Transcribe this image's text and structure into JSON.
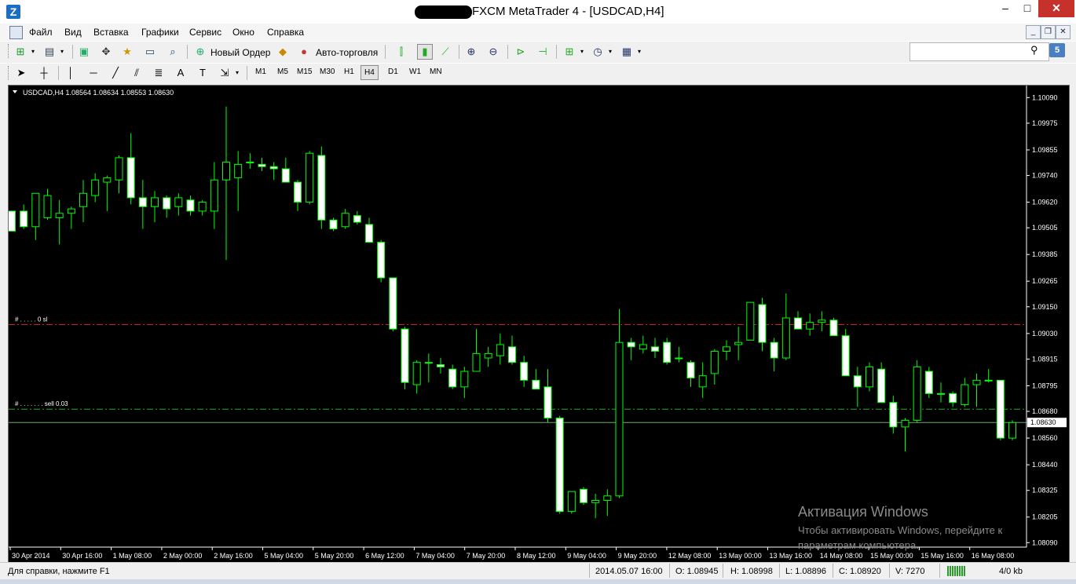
{
  "window": {
    "title": "FXCM MetaTrader 4 - [USDCAD,H4]",
    "minimize_glyph": "–",
    "maximize_glyph": "□",
    "close_glyph": "✕"
  },
  "menu": [
    "Файл",
    "Вид",
    "Вставка",
    "Графики",
    "Сервис",
    "Окно",
    "Справка"
  ],
  "toolbar": {
    "new_order": "Новый Ордер",
    "auto_trading": "Авто-торговля"
  },
  "timeframes": [
    "M1",
    "M5",
    "M15",
    "M30",
    "H1",
    "H4",
    "D1",
    "W1",
    "MN"
  ],
  "active_timeframe": "H4",
  "search": {
    "placeholder": ""
  },
  "notifications_badge": "5",
  "chart_data": {
    "type": "candlestick",
    "symbol_header": "USDCAD,H4  1.08564 1.08634 1.08553 1.08630",
    "background": "#000000",
    "bull_color": "#000000",
    "bear_color": "#ffffff",
    "wick_color": "#00ff00",
    "y_ticks": [
      1.1009,
      1.09975,
      1.09855,
      1.0974,
      1.0962,
      1.09505,
      1.09385,
      1.09265,
      1.0915,
      1.0903,
      1.08915,
      1.08795,
      1.0868,
      1.0856,
      1.0844,
      1.08325,
      1.08205,
      1.0809
    ],
    "y_tick_labels": [
      "1.10090",
      "1.09975",
      "1.09855",
      "1.09740",
      "1.09620",
      "1.09505",
      "1.09385",
      "1.09265",
      "1.09150",
      "1.09030",
      "1.08915",
      "1.08795",
      "1.08680",
      "1.08560",
      "1.08440",
      "1.08325",
      "1.08205",
      "1.08090"
    ],
    "ylim": [
      1.0807,
      1.1013
    ],
    "current_price": "1.08630",
    "current_price_value": 1.0863,
    "x_labels": [
      "30 Apr 2014",
      "30 Apr 16:00",
      "1 May 08:00",
      "2 May 00:00",
      "2 May 16:00",
      "5 May 04:00",
      "5 May 20:00",
      "6 May 12:00",
      "7 May 04:00",
      "7 May 20:00",
      "8 May 12:00",
      "9 May 04:00",
      "9 May 20:00",
      "12 May 08:00",
      "13 May 00:00",
      "13 May 16:00",
      "14 May 08:00",
      "15 May 00:00",
      "15 May 16:00",
      "16 May 08:00"
    ],
    "order_lines": [
      {
        "label": "# . . . . . 0 sl",
        "price": 1.0907,
        "color": "#d02020"
      },
      {
        "label": "# . . . . . . . sell 0.03",
        "price": 1.0869,
        "color": "#22aa22"
      }
    ],
    "candles": [
      [
        1.0958,
        1.0958,
        1.0949,
        1.0949
      ],
      [
        1.0958,
        1.0961,
        1.095,
        1.0951
      ],
      [
        1.0951,
        1.0966,
        1.0945,
        1.0966
      ],
      [
        1.0955,
        1.0968,
        1.0954,
        1.0965
      ],
      [
        1.0955,
        1.0963,
        1.0943,
        1.0957
      ],
      [
        1.0957,
        1.096,
        1.095,
        1.0959
      ],
      [
        1.096,
        1.0972,
        1.0953,
        1.0966
      ],
      [
        1.0965,
        1.0975,
        1.0962,
        1.0972
      ],
      [
        1.0971,
        1.0974,
        1.0958,
        1.0973
      ],
      [
        1.0972,
        1.0983,
        1.0966,
        1.0982
      ],
      [
        1.0982,
        1.0993,
        1.0961,
        1.0964
      ],
      [
        1.0964,
        1.0972,
        1.095,
        1.096
      ],
      [
        1.096,
        1.0967,
        1.0953,
        1.0964
      ],
      [
        1.0964,
        1.0965,
        1.0955,
        1.0959
      ],
      [
        1.096,
        1.0966,
        1.0956,
        1.0964
      ],
      [
        1.0963,
        1.0965,
        1.0956,
        1.0958
      ],
      [
        1.0958,
        1.0963,
        1.0956,
        1.0962
      ],
      [
        1.0958,
        1.098,
        1.095,
        1.0972
      ],
      [
        1.0972,
        1.1005,
        1.0936,
        1.098
      ],
      [
        1.0973,
        1.0985,
        1.0958,
        1.0979
      ],
      [
        1.098,
        1.0984,
        1.0977,
        1.098
      ],
      [
        1.0979,
        1.0982,
        1.0976,
        1.0978
      ],
      [
        1.0978,
        1.098,
        1.0972,
        1.0977
      ],
      [
        1.0977,
        1.0982,
        1.0971,
        1.0971
      ],
      [
        1.0971,
        1.0972,
        1.0958,
        1.0962
      ],
      [
        1.0962,
        1.0985,
        1.0961,
        1.0984
      ],
      [
        1.0983,
        1.0987,
        1.095,
        1.0954
      ],
      [
        1.0954,
        1.0955,
        1.0949,
        1.095
      ],
      [
        1.0951,
        1.0959,
        1.095,
        1.0957
      ],
      [
        1.0956,
        1.0958,
        1.0952,
        1.0953
      ],
      [
        1.0952,
        1.0955,
        1.0944,
        1.0944
      ],
      [
        1.0944,
        1.0945,
        1.0926,
        1.0928
      ],
      [
        1.0928,
        1.0928,
        1.0904,
        1.0905
      ],
      [
        1.0905,
        1.0906,
        1.0878,
        1.0881
      ],
      [
        1.088,
        1.0891,
        1.0876,
        1.089
      ],
      [
        1.089,
        1.0894,
        1.0881,
        1.089
      ],
      [
        1.0889,
        1.0892,
        1.0885,
        1.0888
      ],
      [
        1.0887,
        1.0889,
        1.0878,
        1.0879
      ],
      [
        1.0879,
        1.0888,
        1.0874,
        1.0886
      ],
      [
        1.0886,
        1.0905,
        1.0886,
        1.0894
      ],
      [
        1.0892,
        1.0897,
        1.0888,
        1.0894
      ],
      [
        1.0893,
        1.0903,
        1.0889,
        1.0898
      ],
      [
        1.0897,
        1.0902,
        1.0889,
        1.089
      ],
      [
        1.089,
        1.0893,
        1.0879,
        1.0882
      ],
      [
        1.0882,
        1.0887,
        1.0878,
        1.0878
      ],
      [
        1.0879,
        1.0887,
        1.0863,
        1.0865
      ],
      [
        1.0865,
        1.0866,
        1.0822,
        1.0823
      ],
      [
        1.0823,
        1.0832,
        1.0822,
        1.0832
      ],
      [
        1.0833,
        1.0834,
        1.0826,
        1.0827
      ],
      [
        1.0827,
        1.0831,
        1.082,
        1.0828
      ],
      [
        1.0828,
        1.0833,
        1.0821,
        1.083
      ],
      [
        1.083,
        1.0914,
        1.0829,
        1.0899
      ],
      [
        1.0899,
        1.0901,
        1.0891,
        1.0897
      ],
      [
        1.0896,
        1.0902,
        1.0894,
        1.0898
      ],
      [
        1.0897,
        1.0901,
        1.0892,
        1.0895
      ],
      [
        1.0899,
        1.0901,
        1.0889,
        1.089
      ],
      [
        1.0892,
        1.0897,
        1.089,
        1.0892
      ],
      [
        1.089,
        1.0891,
        1.0879,
        1.0883
      ],
      [
        1.0879,
        1.089,
        1.0874,
        1.0884
      ],
      [
        1.0885,
        1.0896,
        1.088,
        1.0895
      ],
      [
        1.0895,
        1.09,
        1.0891,
        1.0897
      ],
      [
        1.0898,
        1.0906,
        1.0891,
        1.0899
      ],
      [
        1.09,
        1.0917,
        1.09,
        1.0917
      ],
      [
        1.0916,
        1.0919,
        1.0895,
        1.0899
      ],
      [
        1.0899,
        1.0901,
        1.0886,
        1.0892
      ],
      [
        1.0892,
        1.0921,
        1.0891,
        1.091
      ],
      [
        1.091,
        1.0913,
        1.0905,
        1.0905
      ],
      [
        1.0905,
        1.0912,
        1.0902,
        1.0908
      ],
      [
        1.0908,
        1.0913,
        1.0904,
        1.0909
      ],
      [
        1.0909,
        1.091,
        1.0902,
        1.0902
      ],
      [
        1.0902,
        1.0905,
        1.0884,
        1.0884
      ],
      [
        1.0884,
        1.0888,
        1.087,
        1.0879
      ],
      [
        1.0879,
        1.089,
        1.0877,
        1.0888
      ],
      [
        1.0887,
        1.089,
        1.0872,
        1.0872
      ],
      [
        1.0872,
        1.0875,
        1.0858,
        1.0861
      ],
      [
        1.0861,
        1.0865,
        1.085,
        1.0864
      ],
      [
        1.0864,
        1.0891,
        1.0863,
        1.0888
      ],
      [
        1.0886,
        1.0888,
        1.0874,
        1.0876
      ],
      [
        1.0876,
        1.0881,
        1.0872,
        1.0876
      ],
      [
        1.0876,
        1.0877,
        1.087,
        1.0872
      ],
      [
        1.0871,
        1.0883,
        1.087,
        1.088
      ],
      [
        1.088,
        1.0885,
        1.087,
        1.0882
      ],
      [
        1.0882,
        1.0887,
        1.0881,
        1.0882
      ],
      [
        1.0882,
        1.0882,
        1.0855,
        1.0856
      ],
      [
        1.0856,
        1.0864,
        1.0855,
        1.0863
      ]
    ]
  },
  "watermark": {
    "line1": "Активация Windows",
    "line2": "Чтобы активировать Windows, перейдите к",
    "line3": "параметрам компьютера."
  },
  "status": {
    "help": "Для справки, нажмите F1",
    "datetime": "2014.05.07 16:00",
    "open": "O: 1.08945",
    "high": "H: 1.08998",
    "low": "L: 1.08896",
    "close": "C: 1.08920",
    "volume": "V: 7270",
    "traffic": "4/0 kb"
  }
}
